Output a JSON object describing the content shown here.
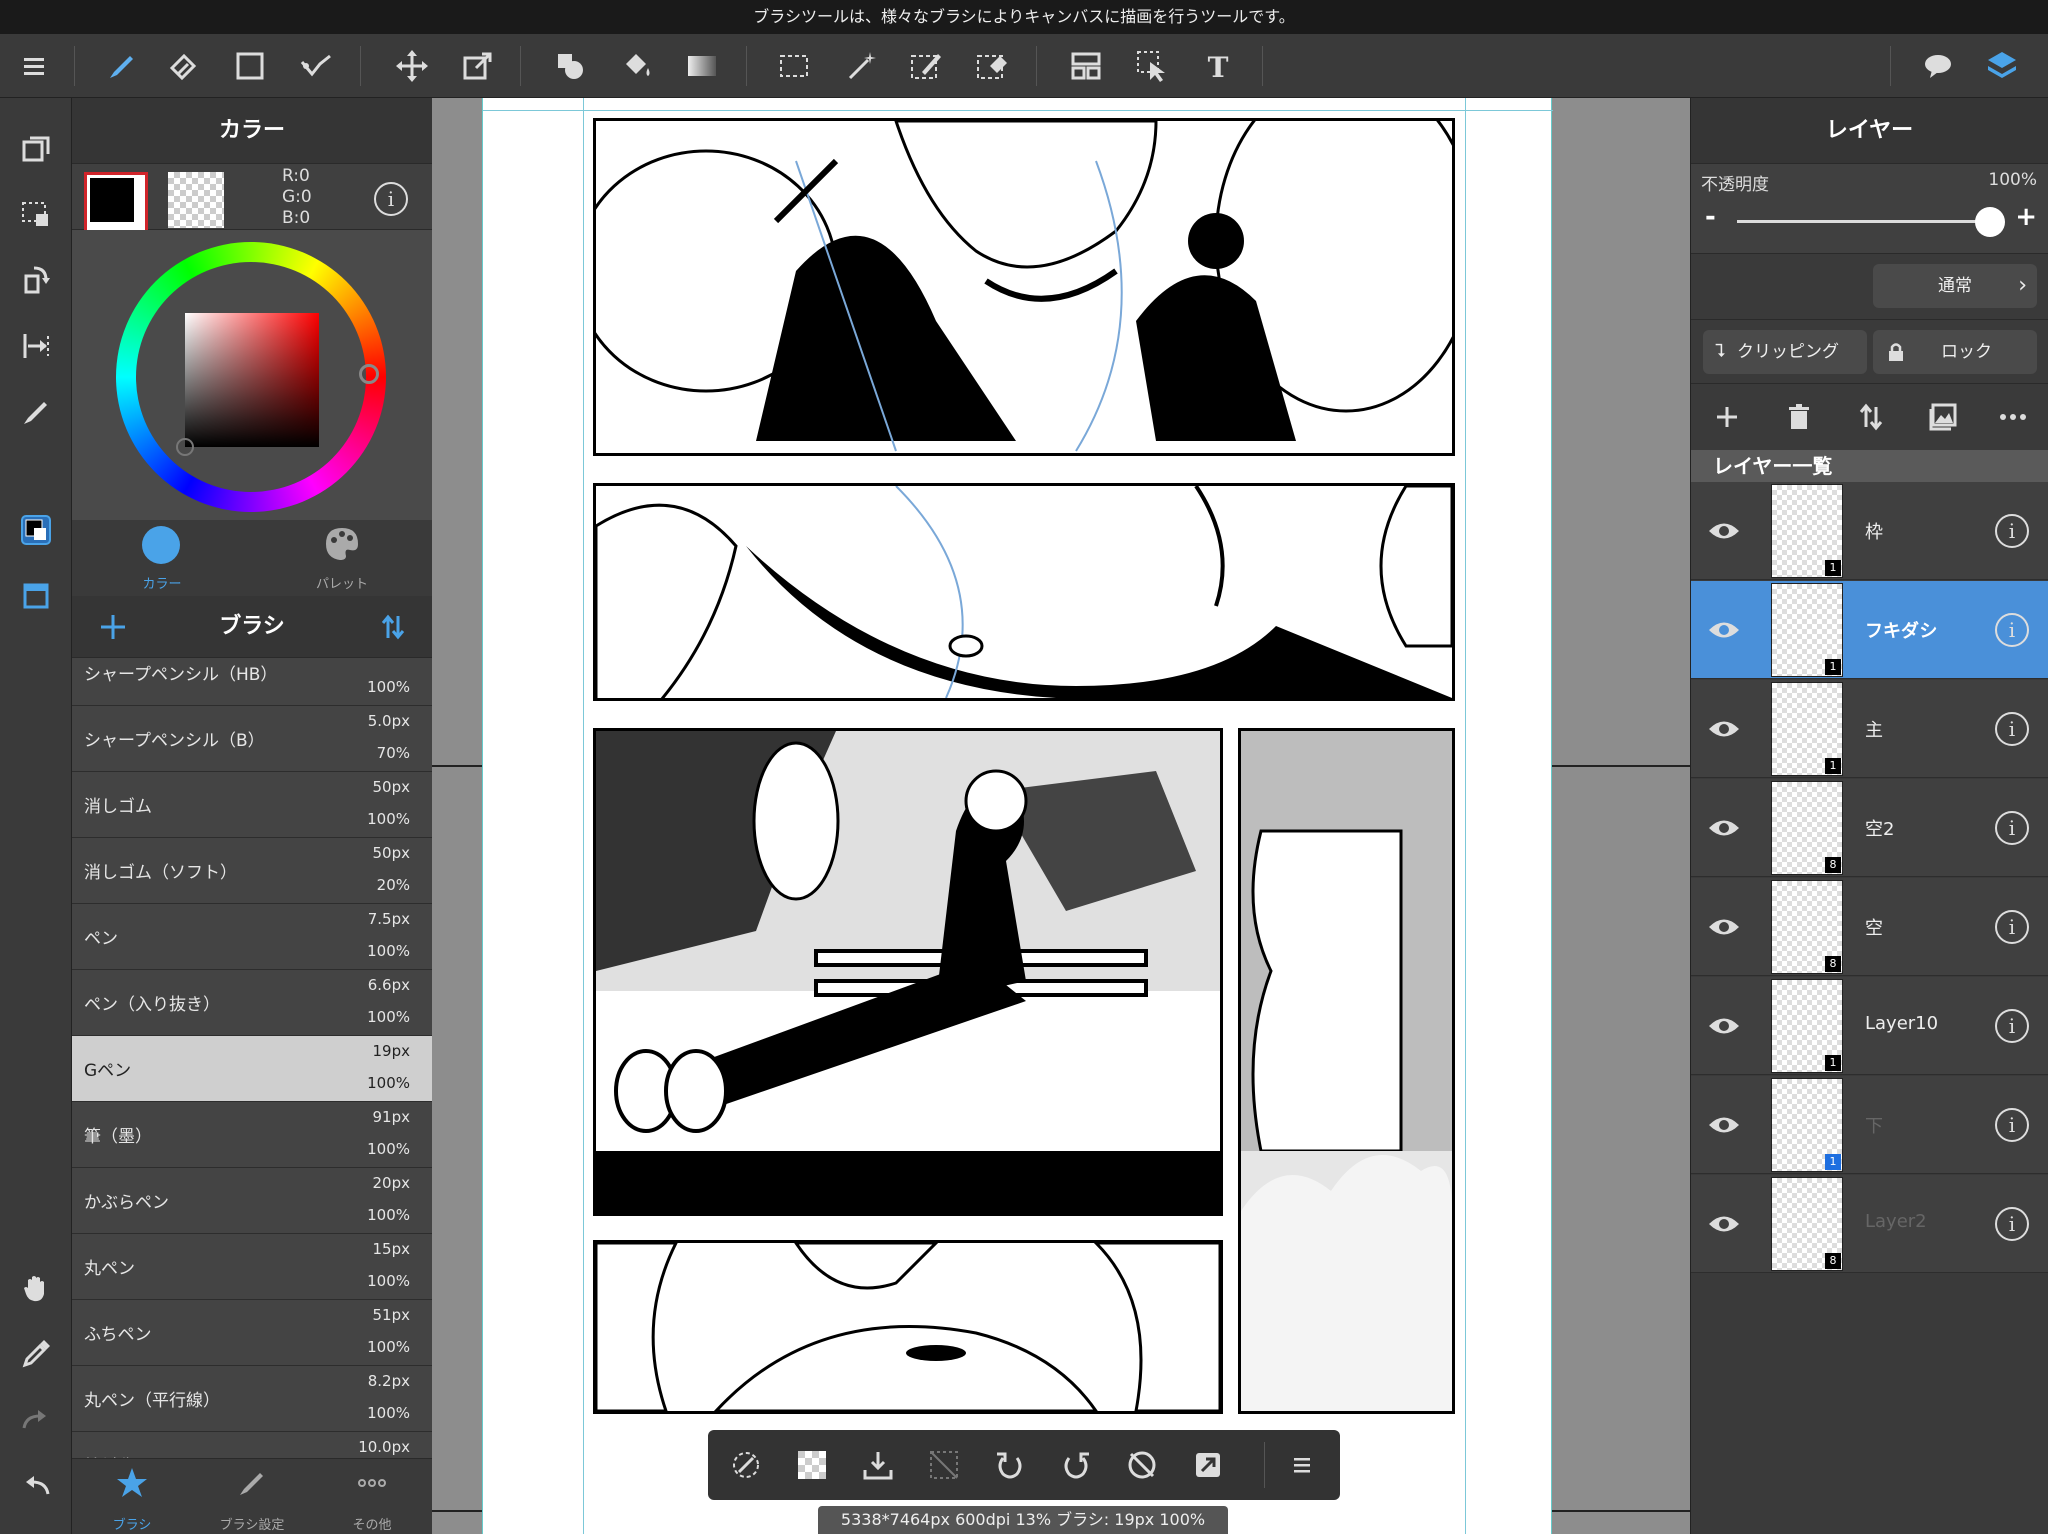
{
  "tooltip": "ブラシツールは、様々なブラシによりキャンバスに描画を行うツールです。",
  "toolbar": {
    "tools": [
      "menu-icon",
      "brush-icon",
      "eraser-icon",
      "rectangle-icon",
      "stabilizer-icon",
      "move-icon",
      "transform-icon",
      "fill-shape-icon",
      "bucket-icon",
      "gradient-icon",
      "select-rect-icon",
      "magic-wand-icon",
      "select-pen-icon",
      "select-eraser-icon",
      "frame-divide-icon",
      "operation-icon",
      "text-icon",
      "speech-bubble-icon",
      "layers-icon"
    ]
  },
  "color_panel": {
    "title": "カラー",
    "r": "R:0",
    "g": "G:0",
    "b": "B:0",
    "primary_color": "#000000",
    "tab_color": "カラー",
    "tab_palette": "パレット"
  },
  "brush_panel": {
    "title": "ブラシ",
    "brushes": [
      {
        "name": "シャープペンシル（HB）",
        "size": "",
        "opacity": "100%"
      },
      {
        "name": "シャープペンシル（B）",
        "size": "5.0px",
        "opacity": "70%"
      },
      {
        "name": "消しゴム",
        "size": "50px",
        "opacity": "100%"
      },
      {
        "name": "消しゴム（ソフト）",
        "size": "50px",
        "opacity": "20%"
      },
      {
        "name": "ペン",
        "size": "7.5px",
        "opacity": "100%"
      },
      {
        "name": "ペン（入り抜き）",
        "size": "6.6px",
        "opacity": "100%"
      },
      {
        "name": "Gペン",
        "size": "19px",
        "opacity": "100%"
      },
      {
        "name": "筆（墨）",
        "size": "91px",
        "opacity": "100%"
      },
      {
        "name": "かぶらペン",
        "size": "20px",
        "opacity": "100%"
      },
      {
        "name": "丸ペン",
        "size": "15px",
        "opacity": "100%"
      },
      {
        "name": "ふちペン",
        "size": "51px",
        "opacity": "100%"
      },
      {
        "name": "丸ペン（平行線）",
        "size": "8.2px",
        "opacity": "100%"
      },
      {
        "name": "線対称",
        "size": "10.0px",
        "opacity": ""
      }
    ],
    "selected_index": 6,
    "tab_brush": "ブラシ",
    "tab_settings": "ブラシ設定",
    "tab_other": "その他"
  },
  "canvas": {
    "info": "5338*7464px 600dpi 13% ブラシ: 19px 100%"
  },
  "layer_panel": {
    "title": "レイヤー",
    "opacity_label": "不透明度",
    "opacity_value": "100%",
    "blend_mode": "通常",
    "clipping": "クリッピング",
    "lock": "ロック",
    "list_title": "レイヤー一覧",
    "layers": [
      {
        "name": "枠",
        "badge": "1"
      },
      {
        "name": "フキダシ",
        "badge": "1"
      },
      {
        "name": "主",
        "badge": "1"
      },
      {
        "name": "空2",
        "badge": "8"
      },
      {
        "name": "空",
        "badge": "8"
      },
      {
        "name": "Layer10",
        "badge": "1"
      },
      {
        "name": "下",
        "badge": "1"
      },
      {
        "name": "Layer2",
        "badge": "8"
      }
    ],
    "selected_index": 1
  }
}
